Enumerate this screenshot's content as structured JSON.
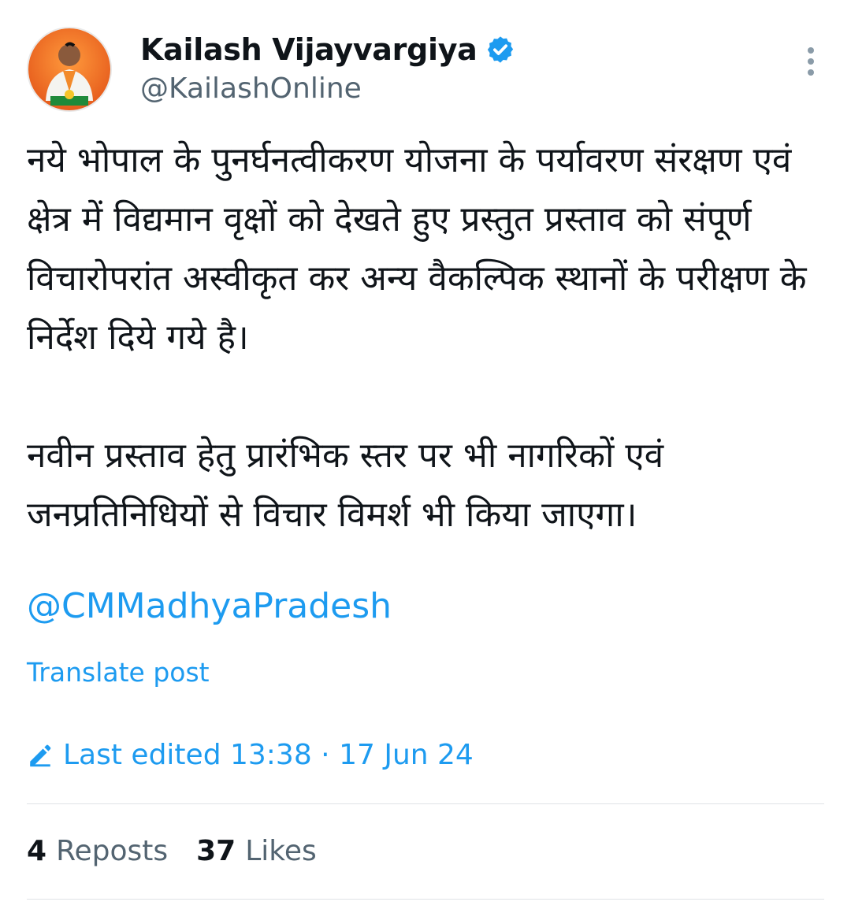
{
  "author": {
    "display_name": "Kailash Vijayvargiya",
    "handle": "@KailashOnline",
    "verified_icon": "verified-badge-icon"
  },
  "menu_icon": "more-vertical-icon",
  "post": {
    "paragraphs": [
      "नये भोपाल के पुनर्घनत्वीकरण योजना के पर्यावरण संरक्षण एवं क्षेत्र में विद्यमान वृक्षों को देखते हुए प्रस्तुत प्रस्ताव को संपूर्ण विचारोपरांत अस्वीकृत कर अन्य वैकल्पिक स्थानों के परीक्षण के निर्देश दिये गये है।",
      "नवीन प्रस्ताव हेतु प्रारंभिक स्तर पर भी नागरिकों एवं जनप्रतिनिधियों से विचार विमर्श भी किया जाएगा।"
    ],
    "mention": "@CMMadhyaPradesh",
    "translate_label": "Translate post",
    "edited_label": "Last edited 13:38 · 17 Jun 24",
    "edited_icon": "pencil-icon"
  },
  "stats": {
    "reposts_count": "4",
    "reposts_label": "Reposts",
    "likes_count": "37",
    "likes_label": "Likes"
  },
  "colors": {
    "link": "#1d9bf0",
    "secondary_text": "#536471",
    "primary_text": "#0f1419",
    "avatar_background": "#f26b21"
  }
}
